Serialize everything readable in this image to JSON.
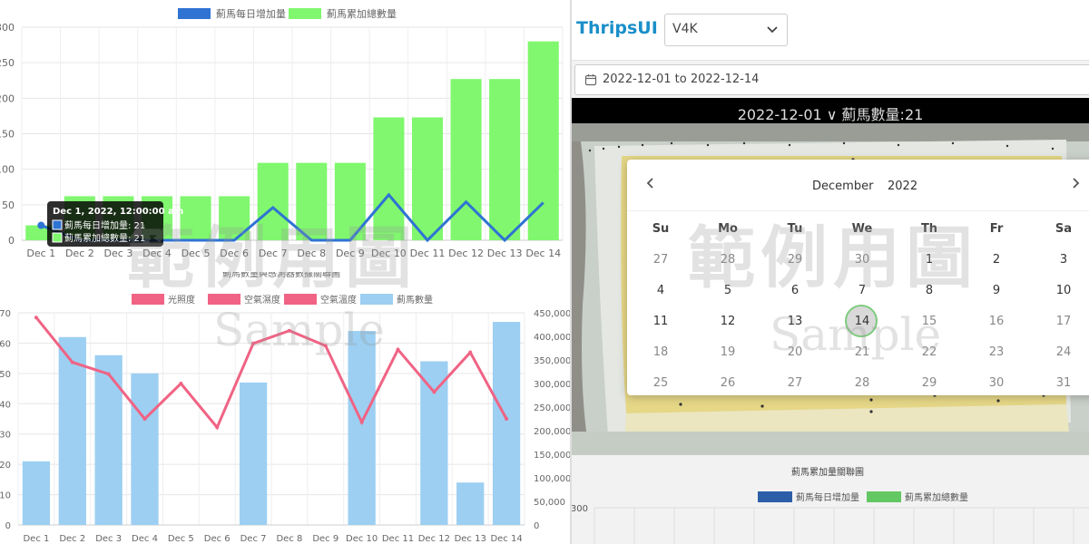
{
  "chart_data": [
    {
      "type": "bar",
      "title": "",
      "legend": [
        {
          "name": "薊馬每日增加量",
          "color": "#2f73d3"
        },
        {
          "name": "薊馬累加總數量",
          "color": "#80f76e"
        }
      ],
      "categories": [
        "Dec 1",
        "Dec 2",
        "Dec 3",
        "Dec 4",
        "Dec 5",
        "Dec 6",
        "Dec 7",
        "Dec 8",
        "Dec 9",
        "Dec 10",
        "Dec 11",
        "Dec 12",
        "Dec 13",
        "Dec 14"
      ],
      "series": [
        {
          "name": "薊馬每日增加量",
          "type": "line",
          "color": "#2f73d3",
          "values": [
            21,
            0,
            0,
            0,
            0,
            0,
            46,
            0,
            0,
            64,
            0,
            54,
            0,
            53
          ]
        },
        {
          "name": "薊馬累加總數量",
          "type": "bar",
          "color": "#80f76e",
          "values": [
            21,
            62,
            62,
            62,
            62,
            62,
            109,
            109,
            109,
            173,
            173,
            227,
            227,
            280
          ]
        }
      ],
      "ylim": [
        0,
        300
      ],
      "yticks": [
        "0",
        "50",
        "100",
        "150",
        "200",
        "250",
        "300"
      ],
      "tooltip": {
        "title": "Dec 1, 2022, 12:00:00 am",
        "lines": [
          "薊馬每日增加量: 21",
          "薊馬累加總數量: 21"
        ]
      }
    },
    {
      "type": "bar",
      "title": "薊馬數量與感測器數據關聯圖",
      "legend": [
        {
          "name": "光照度",
          "color": "#f06384"
        },
        {
          "name": "空氣濕度",
          "color": "#f06384"
        },
        {
          "name": "空氣溫度",
          "color": "#f06384"
        },
        {
          "name": "薊馬數量",
          "color": "#9ccff2"
        }
      ],
      "categories": [
        "Dec 1",
        "Dec 2",
        "Dec 3",
        "Dec 4",
        "Dec 5",
        "Dec 6",
        "Dec 7",
        "Dec 8",
        "Dec 9",
        "Dec 10",
        "Dec 11",
        "Dec 12",
        "Dec 13",
        "Dec 14"
      ],
      "series": [
        {
          "name": "薊馬數量",
          "type": "bar",
          "axis": "left",
          "color": "#9ccff2",
          "values": [
            21,
            62,
            56,
            50,
            0,
            0,
            47,
            0,
            0,
            64,
            0,
            54,
            14,
            67
          ]
        },
        {
          "name": "光照度",
          "type": "line",
          "axis": "right",
          "color": "#f06384",
          "values": [
            440000,
            345000,
            320000,
            225000,
            300000,
            207000,
            385000,
            412000,
            380000,
            218000,
            372000,
            282000,
            366000,
            225000
          ]
        }
      ],
      "ylim_left": [
        0,
        70
      ],
      "yticks_left": [
        "0",
        "10",
        "20",
        "30",
        "40",
        "50",
        "60",
        "70"
      ],
      "ylim_right": [
        0,
        450000
      ],
      "yticks_right": [
        "0",
        "50,000",
        "100,000",
        "150,000",
        "200,000",
        "250,000",
        "300,000",
        "350,000",
        "400,000",
        "450,000"
      ]
    },
    {
      "type": "bar",
      "title": "薊馬累加量關聯圖",
      "legend": [
        {
          "name": "薊馬每日增加量",
          "color": "#2d5ea8"
        },
        {
          "name": "薊馬累加總數量",
          "color": "#63c763"
        }
      ],
      "yticks": [
        "300"
      ]
    }
  ],
  "watermark": {
    "cn": "範例用圖",
    "en": "Sample"
  },
  "header": {
    "brand": "ThripsUI",
    "device": "V4K"
  },
  "date_range": "2022-12-01 to 2022-12-14",
  "photo_title": "2022-12-01 ∨ 薊馬數量:21",
  "calendar": {
    "month": "December",
    "year": "2022",
    "weekdays": [
      "Su",
      "Mo",
      "Tu",
      "We",
      "Th",
      "Fr",
      "Sa"
    ],
    "weeks": [
      [
        {
          "d": "27",
          "m": "prev"
        },
        {
          "d": "28",
          "m": "prev"
        },
        {
          "d": "29",
          "m": "prev"
        },
        {
          "d": "30",
          "m": "prev"
        },
        {
          "d": "1",
          "m": "cur"
        },
        {
          "d": "2",
          "m": "cur"
        },
        {
          "d": "3",
          "m": "cur"
        }
      ],
      [
        {
          "d": "4",
          "m": "cur"
        },
        {
          "d": "5",
          "m": "cur"
        },
        {
          "d": "6",
          "m": "cur"
        },
        {
          "d": "7",
          "m": "cur"
        },
        {
          "d": "8",
          "m": "cur"
        },
        {
          "d": "9",
          "m": "cur"
        },
        {
          "d": "10",
          "m": "cur"
        }
      ],
      [
        {
          "d": "11",
          "m": "cur"
        },
        {
          "d": "12",
          "m": "cur"
        },
        {
          "d": "13",
          "m": "cur"
        },
        {
          "d": "14",
          "m": "sel"
        },
        {
          "d": "15",
          "m": "dis"
        },
        {
          "d": "16",
          "m": "dis"
        },
        {
          "d": "17",
          "m": "dis"
        }
      ],
      [
        {
          "d": "18",
          "m": "dis"
        },
        {
          "d": "19",
          "m": "dis"
        },
        {
          "d": "20",
          "m": "dis"
        },
        {
          "d": "21",
          "m": "dis"
        },
        {
          "d": "22",
          "m": "dis"
        },
        {
          "d": "23",
          "m": "dis"
        },
        {
          "d": "24",
          "m": "dis"
        }
      ],
      [
        {
          "d": "25",
          "m": "dis"
        },
        {
          "d": "26",
          "m": "dis"
        },
        {
          "d": "27",
          "m": "dis"
        },
        {
          "d": "28",
          "m": "dis"
        },
        {
          "d": "29",
          "m": "dis"
        },
        {
          "d": "30",
          "m": "dis"
        },
        {
          "d": "31",
          "m": "dis"
        }
      ]
    ]
  }
}
